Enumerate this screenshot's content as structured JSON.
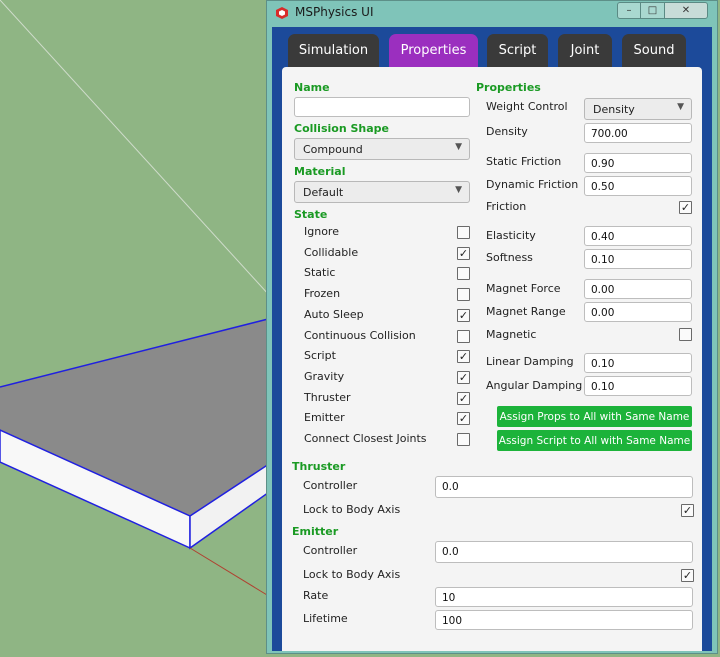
{
  "window": {
    "title": "MSPhysics UI",
    "controls": {
      "minimize": "–",
      "maximize": "□",
      "close": "✕"
    }
  },
  "tabs": [
    {
      "label": "Simulation",
      "active": false
    },
    {
      "label": "Properties",
      "active": true
    },
    {
      "label": "Script",
      "active": false
    },
    {
      "label": "Joint",
      "active": false
    },
    {
      "label": "Sound",
      "active": false
    }
  ],
  "left": {
    "name_heading": "Name",
    "name_value": "",
    "collision_heading": "Collision Shape",
    "collision_value": "Compound",
    "material_heading": "Material",
    "material_value": "Default",
    "state_heading": "State",
    "state_items": [
      {
        "label": "Ignore",
        "checked": false
      },
      {
        "label": "Collidable",
        "checked": true
      },
      {
        "label": "Static",
        "checked": false
      },
      {
        "label": "Frozen",
        "checked": false
      },
      {
        "label": "Auto Sleep",
        "checked": true
      },
      {
        "label": "Continuous Collision",
        "checked": false
      },
      {
        "label": "Script",
        "checked": true
      },
      {
        "label": "Gravity",
        "checked": true
      },
      {
        "label": "Thruster",
        "checked": true
      },
      {
        "label": "Emitter",
        "checked": true
      },
      {
        "label": "Connect Closest Joints",
        "checked": false
      }
    ]
  },
  "right": {
    "heading": "Properties",
    "weight_control_label": "Weight Control",
    "weight_control_value": "Density",
    "density_label": "Density",
    "density_value": "700.00",
    "static_friction_label": "Static Friction",
    "static_friction_value": "0.90",
    "dynamic_friction_label": "Dynamic Friction",
    "dynamic_friction_value": "0.50",
    "friction_label": "Friction",
    "friction_checked": true,
    "elasticity_label": "Elasticity",
    "elasticity_value": "0.40",
    "softness_label": "Softness",
    "softness_value": "0.10",
    "magnet_force_label": "Magnet Force",
    "magnet_force_value": "0.00",
    "magnet_range_label": "Magnet Range",
    "magnet_range_value": "0.00",
    "magnetic_label": "Magnetic",
    "magnetic_checked": false,
    "linear_damping_label": "Linear Damping",
    "linear_damping_value": "0.10",
    "angular_damping_label": "Angular Damping",
    "angular_damping_value": "0.10",
    "assign_props_label": "Assign Props to All with Same Name",
    "assign_script_label": "Assign Script to All with Same Name"
  },
  "thruster": {
    "heading": "Thruster",
    "controller_label": "Controller",
    "controller_value": "0.0",
    "lock_label": "Lock to Body Axis",
    "lock_checked": true
  },
  "emitter": {
    "heading": "Emitter",
    "controller_label": "Controller",
    "controller_value": "0.0",
    "lock_label": "Lock to Body Axis",
    "lock_checked": true,
    "rate_label": "Rate",
    "rate_value": "10",
    "lifetime_label": "Lifetime",
    "lifetime_value": "100"
  },
  "colors": {
    "viewport_bg": "#8fb584",
    "window_frame": "#7fc4b9",
    "tab_active": "#9b2fbf",
    "tab_inactive": "#3a3a3a",
    "section_heading": "#1a9a23",
    "button_green": "#1cb33a"
  },
  "icons": {
    "app": "sketchup-logo-icon",
    "checkbox": "check-mark-icon",
    "dropdown": "chevron-down-icon"
  }
}
